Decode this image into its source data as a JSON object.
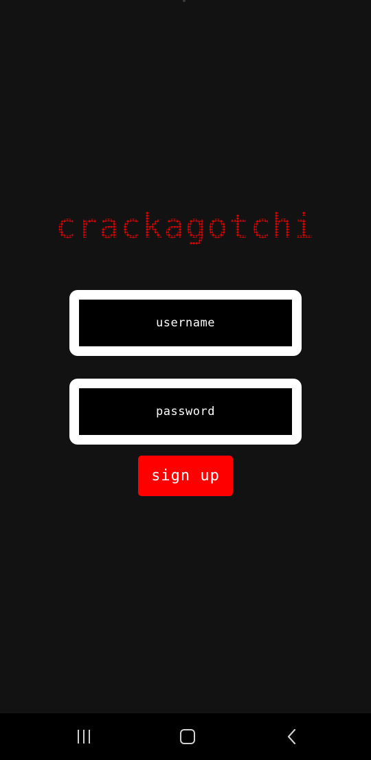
{
  "app": {
    "title": "crackagotchi"
  },
  "form": {
    "username_placeholder": "username",
    "username_value": "",
    "password_placeholder": "password",
    "password_value": "",
    "signup_label": "sign up"
  },
  "navbar": {
    "recents_icon": "recents-icon",
    "home_icon": "home-icon",
    "back_icon": "back-icon"
  },
  "colors": {
    "background": "#121212",
    "title": "#e30000",
    "button": "#ff0000",
    "field_border": "#ffffff",
    "field_fill": "#000000",
    "navbar": "#000000"
  }
}
